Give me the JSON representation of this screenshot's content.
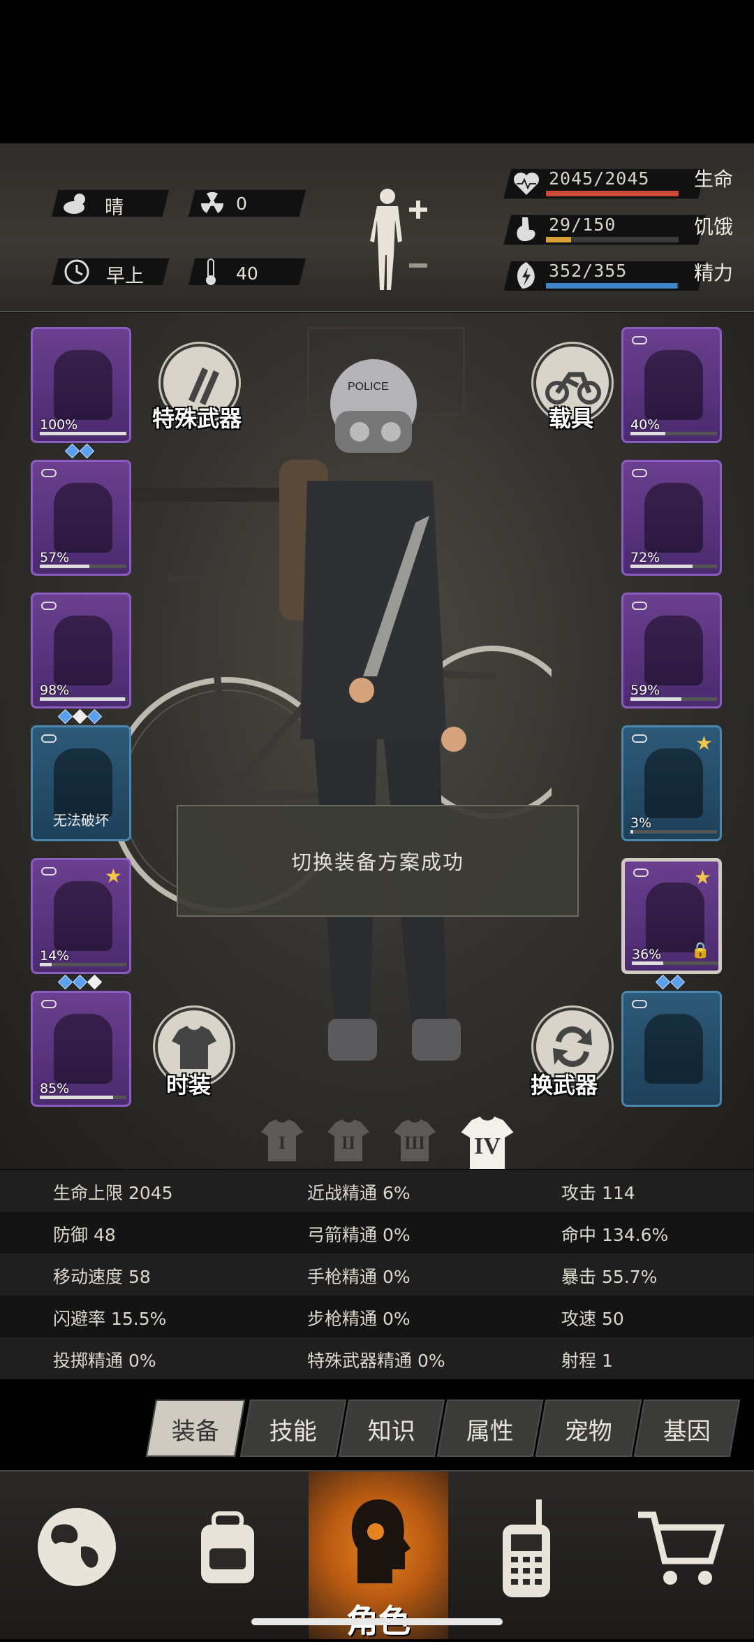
{
  "status": {
    "weather": {
      "icon": "weather-cloud-sun-icon",
      "label": "晴"
    },
    "radiation": {
      "icon": "radiation-icon",
      "value": "0"
    },
    "time": {
      "icon": "clock-icon",
      "label": "早上"
    },
    "temperature": {
      "icon": "thermometer-icon",
      "value": "40"
    },
    "health": {
      "icon": "heart-icon",
      "value": "2045/2045",
      "label": "生命",
      "fill": 1.0,
      "color": "#d0483a"
    },
    "hunger": {
      "icon": "stomach-icon",
      "value": "29/150",
      "label": "饥饿",
      "fill": 0.19,
      "color": "#d8a236"
    },
    "energy": {
      "icon": "energy-icon",
      "value": "352/355",
      "label": "精力",
      "fill": 0.99,
      "color": "#3f86c8"
    }
  },
  "left_slots": [
    {
      "name": "helmet",
      "percent": "100%",
      "durability": 1.0,
      "gems": [
        "blue",
        "blue"
      ]
    },
    {
      "name": "shirt",
      "percent": "57%",
      "durability": 0.57,
      "gems": []
    },
    {
      "name": "jacket",
      "percent": "98%",
      "durability": 0.98,
      "gems": [
        "blue",
        "white",
        "blue"
      ]
    },
    {
      "name": "backpack",
      "label": "无法破坏",
      "gems": []
    },
    {
      "name": "pants",
      "percent": "14%",
      "durability": 0.14,
      "gems": [
        "blue",
        "blue",
        "white"
      ]
    },
    {
      "name": "boots",
      "percent": "85%",
      "durability": 0.85,
      "gems": []
    }
  ],
  "right_slots": [
    {
      "name": "goggles",
      "percent": "40%",
      "durability": 0.4
    },
    {
      "name": "gas-mask",
      "percent": "72%",
      "durability": 0.72
    },
    {
      "name": "police-vest",
      "percent": "59%",
      "durability": 0.59
    },
    {
      "name": "shield",
      "percent": "3%",
      "durability": 0.03
    },
    {
      "name": "machete",
      "percent": "36%",
      "durability": 0.36
    },
    {
      "name": "dynamite",
      "percent": "",
      "durability": 0
    }
  ],
  "buttons": {
    "special_weapon": "特殊武器",
    "vehicle": "载具",
    "costume": "时装",
    "swap_weapon": "换武器"
  },
  "toast": "切换装备方案成功",
  "loadouts": [
    "I",
    "II",
    "III",
    "IV"
  ],
  "stats": [
    [
      "生命上限 2045",
      "近战精通 6%",
      "攻击 114"
    ],
    [
      "防御 48",
      "弓箭精通 0%",
      "命中 134.6%"
    ],
    [
      "移动速度 58",
      "手枪精通 0%",
      "暴击 55.7%"
    ],
    [
      "闪避率 15.5%",
      "步枪精通 0%",
      "攻速 50"
    ],
    [
      "投掷精通 0%",
      "特殊武器精通 0%",
      "射程 1"
    ]
  ],
  "tabs": [
    "装备",
    "技能",
    "知识",
    "属性",
    "宠物",
    "基因"
  ],
  "nav": {
    "map": "globe-icon",
    "bag": "backpack-icon",
    "character": "角色",
    "radio": "walkie-talkie-icon",
    "shop": "cart-icon"
  }
}
